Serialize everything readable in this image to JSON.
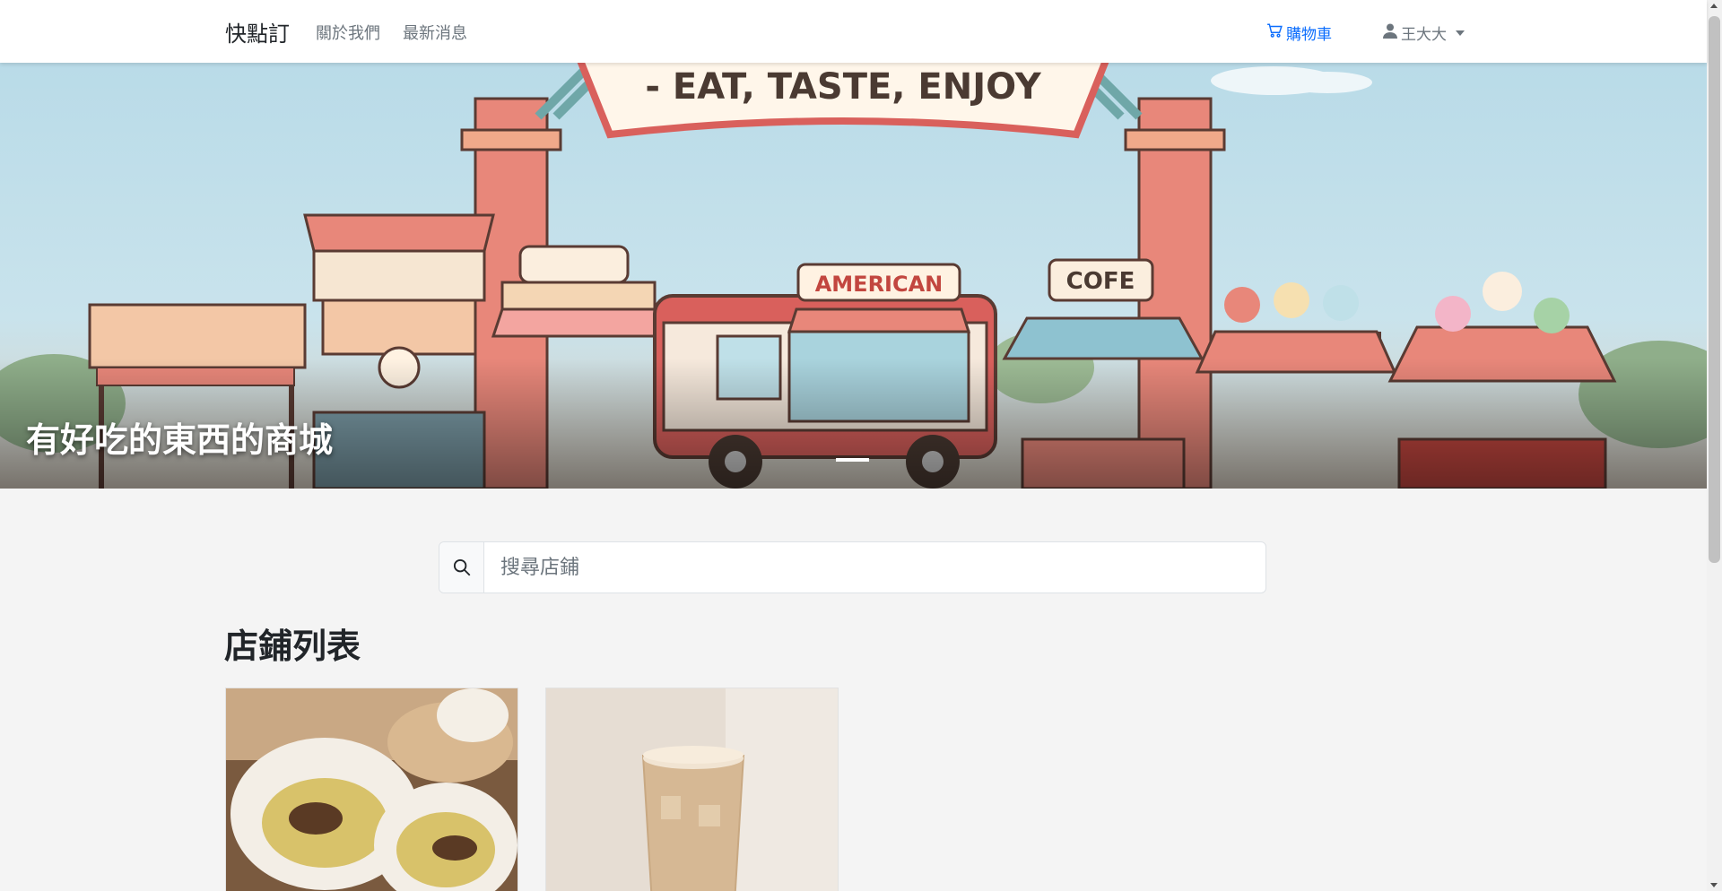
{
  "navbar": {
    "brand": "快點訂",
    "links": [
      {
        "label": "關於我們"
      },
      {
        "label": "最新消息"
      }
    ],
    "cart_label": "購物車",
    "user_name": "王大大",
    "cart_icon": "cart-icon",
    "user_icon": "person-icon"
  },
  "hero": {
    "caption": "有好吃的東西的商城",
    "sign_text": "- EAT, TASTE, ENJOY",
    "truck_sign": "AMERICAN",
    "stand_sign": "COFE"
  },
  "search": {
    "placeholder": "搜尋店鋪",
    "icon": "search-icon"
  },
  "shops": {
    "title": "店鋪列表",
    "items": [
      {
        "image": "steamed-bun-photo"
      },
      {
        "image": "iced-milk-tea-photo"
      }
    ]
  },
  "colors": {
    "accent": "#0d6efd",
    "muted": "#6c757d",
    "background": "#f4f4f4"
  }
}
